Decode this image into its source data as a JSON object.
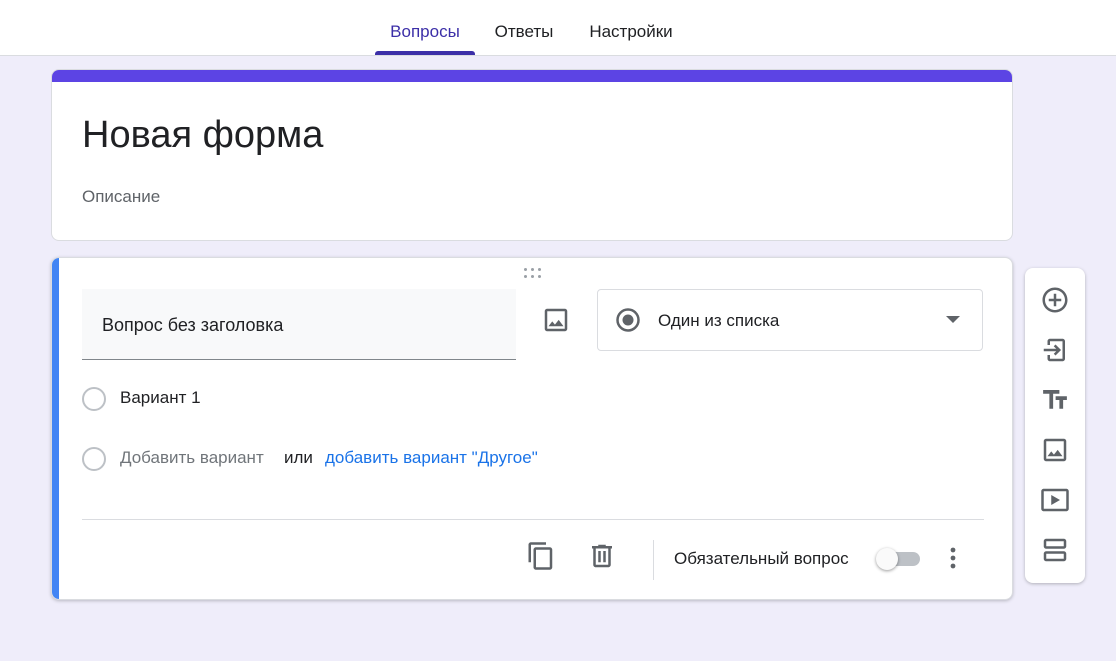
{
  "tabs": [
    {
      "label": "Вопросы",
      "active": true
    },
    {
      "label": "Ответы",
      "active": false
    },
    {
      "label": "Настройки",
      "active": false
    }
  ],
  "form": {
    "title": "Новая форма",
    "description_placeholder": "Описание"
  },
  "question": {
    "title": "Вопрос без заголовка",
    "type_label": "Один из списка",
    "options": [
      "Вариант 1"
    ],
    "add_option_label": "Добавить вариант",
    "or_label": "или",
    "add_other_label": "добавить вариант \"Другое\"",
    "required_label": "Обязательный вопрос",
    "required": false
  },
  "colors": {
    "accent": "#5c44e4",
    "active_tab": "#3c2fa8",
    "question_accent": "#4285f4",
    "link": "#1a73e8",
    "background": "#efedfa"
  },
  "toolbar_icons": [
    "add-circle-icon",
    "import-question-icon",
    "title-text-icon",
    "image-icon",
    "video-icon",
    "section-icon"
  ]
}
